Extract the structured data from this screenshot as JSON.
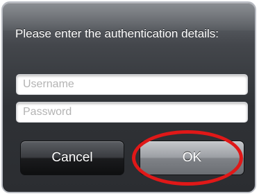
{
  "dialog": {
    "prompt": "Please enter the authentication details:",
    "username": {
      "placeholder": "Username",
      "value": ""
    },
    "password": {
      "placeholder": "Password",
      "value": ""
    },
    "buttons": {
      "cancel_label": "Cancel",
      "ok_label": "OK"
    },
    "highlight": {
      "target": "ok-button",
      "color": "#e01818"
    }
  }
}
